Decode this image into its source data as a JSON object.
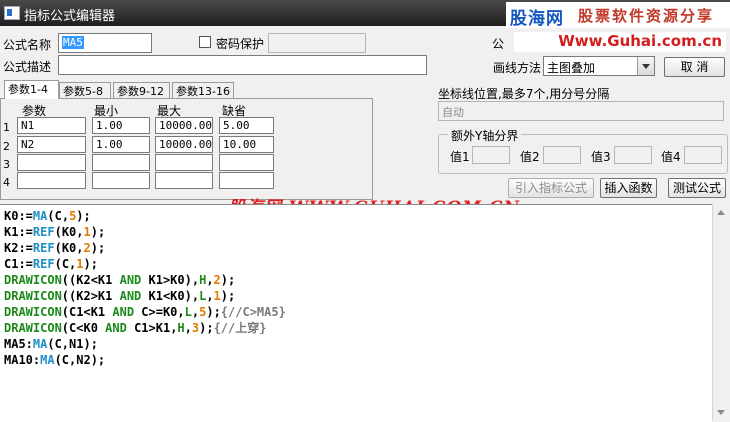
{
  "window": {
    "title": "指标公式编辑器"
  },
  "watermarks": {
    "brand": "股海网",
    "slogan": "股票软件资源分享",
    "url": "Www.Guhai.com.cn",
    "overlay": "股海网 WWW.GUHAI.COM.CN"
  },
  "form": {
    "name_label": "公式名称",
    "name_value": "MA5",
    "password_label": "密码保护",
    "desc_label": "公式描述",
    "desc_value": "",
    "hidden_label": "公",
    "draw_method_label": "画线方法",
    "draw_method_value": "主图叠加",
    "cancel_button": "取  消"
  },
  "tabs": [
    "参数1-4",
    "参数5-8",
    "参数9-12",
    "参数13-16"
  ],
  "params": {
    "headers": {
      "name": "参数",
      "min": "最小",
      "max": "最大",
      "default": "缺省"
    },
    "rows": [
      {
        "num": "1",
        "name": "N1",
        "min": "1.00",
        "max": "10000.00",
        "default": "5.00"
      },
      {
        "num": "2",
        "name": "N2",
        "min": "1.00",
        "max": "10000.00",
        "default": "10.00"
      },
      {
        "num": "3",
        "name": "",
        "min": "",
        "max": "",
        "default": ""
      },
      {
        "num": "4",
        "name": "",
        "min": "",
        "max": "",
        "default": ""
      }
    ]
  },
  "coord": {
    "label": "坐标线位置,最多7个,用分号分隔",
    "value": "自动"
  },
  "yaxis": {
    "title": "额外Y轴分界",
    "v1": "值1",
    "v2": "值2",
    "v3": "值3",
    "v4": "值4"
  },
  "buttons": {
    "import": "引入指标公式",
    "insert_fn": "插入函数",
    "test": "测试公式"
  },
  "code": [
    [
      [
        "K0:=",
        "#000000"
      ],
      [
        "MA",
        "#1e90c8"
      ],
      [
        "(",
        "#000000"
      ],
      [
        "C",
        "#000000"
      ],
      [
        ",",
        "#000000"
      ],
      [
        "5",
        "#e07b00"
      ],
      [
        ");",
        "#000000"
      ]
    ],
    [
      [
        "K1:=",
        "#000000"
      ],
      [
        "REF",
        "#1e90c8"
      ],
      [
        "(K0,",
        "#000000"
      ],
      [
        "1",
        "#e07b00"
      ],
      [
        ");",
        "#000000"
      ]
    ],
    [
      [
        "K2:=",
        "#000000"
      ],
      [
        "REF",
        "#1e90c8"
      ],
      [
        "(K0,",
        "#000000"
      ],
      [
        "2",
        "#e07b00"
      ],
      [
        ");",
        "#000000"
      ]
    ],
    [
      [
        "C1:=",
        "#000000"
      ],
      [
        "REF",
        "#1e90c8"
      ],
      [
        "(C,",
        "#000000"
      ],
      [
        "1",
        "#e07b00"
      ],
      [
        ");",
        "#000000"
      ]
    ],
    [
      [
        "DRAWICON",
        "#1a8a1a"
      ],
      [
        "((K2<K1 ",
        "#000000"
      ],
      [
        "AND",
        "#1a8a1a"
      ],
      [
        " K1>K0),",
        "#000000"
      ],
      [
        "H",
        "#1a8a1a"
      ],
      [
        ",",
        "#000000"
      ],
      [
        "2",
        "#e07b00"
      ],
      [
        ");",
        "#000000"
      ]
    ],
    [
      [
        "DRAWICON",
        "#1a8a1a"
      ],
      [
        "((K2>K1 ",
        "#000000"
      ],
      [
        "AND",
        "#1a8a1a"
      ],
      [
        " K1<K0),",
        "#000000"
      ],
      [
        "L",
        "#1a8a1a"
      ],
      [
        ",",
        "#000000"
      ],
      [
        "1",
        "#e07b00"
      ],
      [
        ");",
        "#000000"
      ]
    ],
    [
      [
        "DRAWICON",
        "#1a8a1a"
      ],
      [
        "(C1<K1 ",
        "#000000"
      ],
      [
        "AND",
        "#1a8a1a"
      ],
      [
        " C>=K0,",
        "#000000"
      ],
      [
        "L",
        "#1a8a1a"
      ],
      [
        ",",
        "#000000"
      ],
      [
        "5",
        "#e07b00"
      ],
      [
        ");",
        "#000000"
      ],
      [
        "{//C>MA5}",
        "#7a7a7a"
      ]
    ],
    [
      [
        "DRAWICON",
        "#1a8a1a"
      ],
      [
        "(C<K0 ",
        "#000000"
      ],
      [
        "AND",
        "#1a8a1a"
      ],
      [
        " C1>K1,",
        "#000000"
      ],
      [
        "H",
        "#1a8a1a"
      ],
      [
        ",",
        "#000000"
      ],
      [
        "3",
        "#e07b00"
      ],
      [
        ");",
        "#000000"
      ],
      [
        "{//上穿}",
        "#7a7a7a"
      ]
    ],
    [
      [
        "MA5:",
        "#000000"
      ],
      [
        "MA",
        "#1e90c8"
      ],
      [
        "(C,N1);",
        "#000000"
      ]
    ],
    [
      [
        "MA10:",
        "#000000"
      ],
      [
        "MA",
        "#1e90c8"
      ],
      [
        "(C,N2);",
        "#000000"
      ]
    ]
  ]
}
